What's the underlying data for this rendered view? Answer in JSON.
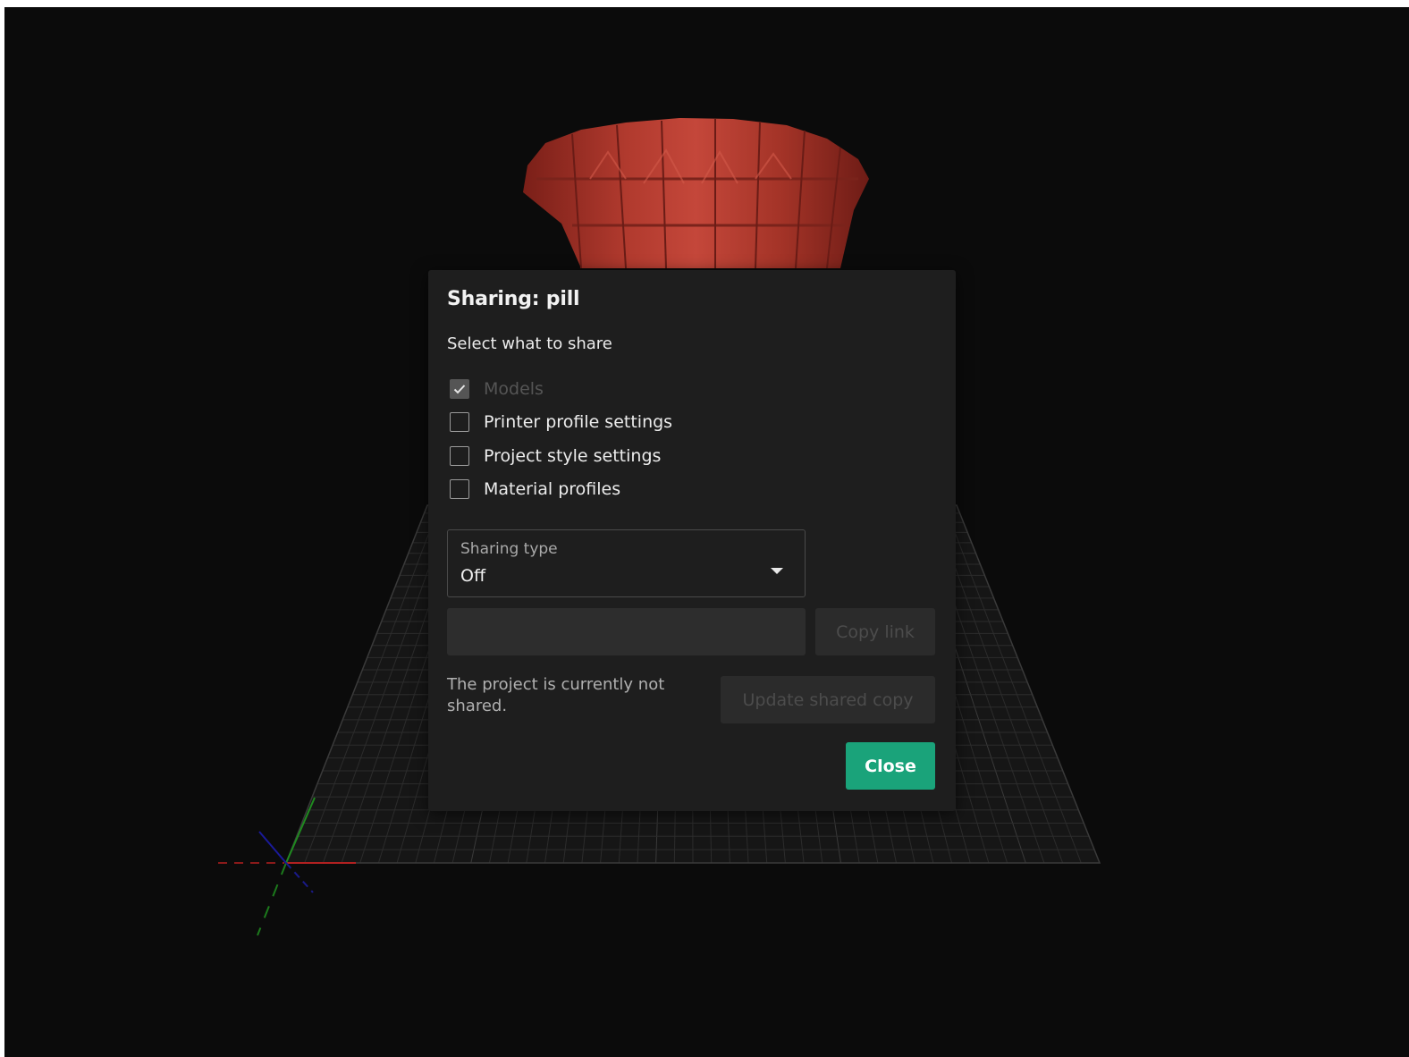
{
  "dialog": {
    "title": "Sharing: pill",
    "subtitle": "Select what to share",
    "options": [
      {
        "label": "Models",
        "checked": true,
        "disabled": true
      },
      {
        "label": "Printer profile settings",
        "checked": false,
        "disabled": false
      },
      {
        "label": "Project style settings",
        "checked": false,
        "disabled": false
      },
      {
        "label": "Material profiles",
        "checked": false,
        "disabled": false
      }
    ],
    "sharing_type": {
      "label": "Sharing type",
      "value": "Off"
    },
    "link_field": {
      "value": ""
    },
    "copy_link_label": "Copy link",
    "status_text": "The project is currently not shared.",
    "update_label": "Update shared copy",
    "close_label": "Close"
  },
  "scene": {
    "model_color": "#a8362c",
    "accent_color": "#1aa37a"
  }
}
